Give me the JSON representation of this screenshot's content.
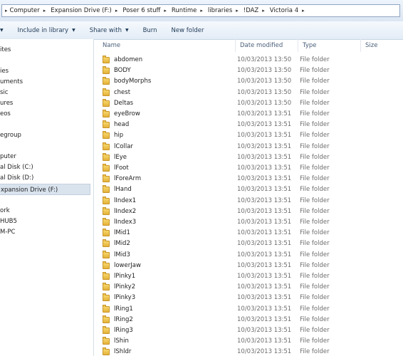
{
  "address": {
    "crumbs": [
      "Computer",
      "Expansion Drive (F:)",
      "Poser 6 stuff",
      "Runtime",
      "libraries",
      "!DAZ",
      "Victoria 4"
    ]
  },
  "toolbar": {
    "include_label": "Include in library",
    "share_label": "Share with",
    "burn_label": "Burn",
    "new_folder_label": "New folder"
  },
  "nav": {
    "items": [
      "ites",
      "ies",
      "uments",
      "sic",
      "ures",
      "eos",
      "egroup",
      "puter",
      "al Disk (C:)",
      "al Disk (D:)",
      "xpansion Drive (F:)",
      "ork",
      "HUB5",
      "M-PC"
    ]
  },
  "columns": {
    "name": "Name",
    "date": "Date modified",
    "type": "Type",
    "size": "Size"
  },
  "files": [
    {
      "name": "abdomen",
      "date": "10/03/2013 13:50",
      "type": "File folder"
    },
    {
      "name": "BODY",
      "date": "10/03/2013 13:50",
      "type": "File folder"
    },
    {
      "name": "bodyMorphs",
      "date": "10/03/2013 13:50",
      "type": "File folder"
    },
    {
      "name": "chest",
      "date": "10/03/2013 13:50",
      "type": "File folder"
    },
    {
      "name": "Deltas",
      "date": "10/03/2013 13:50",
      "type": "File folder"
    },
    {
      "name": "eyeBrow",
      "date": "10/03/2013 13:51",
      "type": "File folder"
    },
    {
      "name": "head",
      "date": "10/03/2013 13:51",
      "type": "File folder"
    },
    {
      "name": "hip",
      "date": "10/03/2013 13:51",
      "type": "File folder"
    },
    {
      "name": "lCollar",
      "date": "10/03/2013 13:51",
      "type": "File folder"
    },
    {
      "name": "lEye",
      "date": "10/03/2013 13:51",
      "type": "File folder"
    },
    {
      "name": "lFoot",
      "date": "10/03/2013 13:51",
      "type": "File folder"
    },
    {
      "name": "lForeArm",
      "date": "10/03/2013 13:51",
      "type": "File folder"
    },
    {
      "name": "lHand",
      "date": "10/03/2013 13:51",
      "type": "File folder"
    },
    {
      "name": "lIndex1",
      "date": "10/03/2013 13:51",
      "type": "File folder"
    },
    {
      "name": "lIndex2",
      "date": "10/03/2013 13:51",
      "type": "File folder"
    },
    {
      "name": "lIndex3",
      "date": "10/03/2013 13:51",
      "type": "File folder"
    },
    {
      "name": "lMid1",
      "date": "10/03/2013 13:51",
      "type": "File folder"
    },
    {
      "name": "lMid2",
      "date": "10/03/2013 13:51",
      "type": "File folder"
    },
    {
      "name": "lMid3",
      "date": "10/03/2013 13:51",
      "type": "File folder"
    },
    {
      "name": "lowerJaw",
      "date": "10/03/2013 13:51",
      "type": "File folder"
    },
    {
      "name": "lPinky1",
      "date": "10/03/2013 13:51",
      "type": "File folder"
    },
    {
      "name": "lPinky2",
      "date": "10/03/2013 13:51",
      "type": "File folder"
    },
    {
      "name": "lPinky3",
      "date": "10/03/2013 13:51",
      "type": "File folder"
    },
    {
      "name": "lRing1",
      "date": "10/03/2013 13:51",
      "type": "File folder"
    },
    {
      "name": "lRing2",
      "date": "10/03/2013 13:51",
      "type": "File folder"
    },
    {
      "name": "lRing3",
      "date": "10/03/2013 13:51",
      "type": "File folder"
    },
    {
      "name": "lShin",
      "date": "10/03/2013 13:51",
      "type": "File folder"
    },
    {
      "name": "lShldr",
      "date": "10/03/2013 13:51",
      "type": "File folder"
    }
  ]
}
